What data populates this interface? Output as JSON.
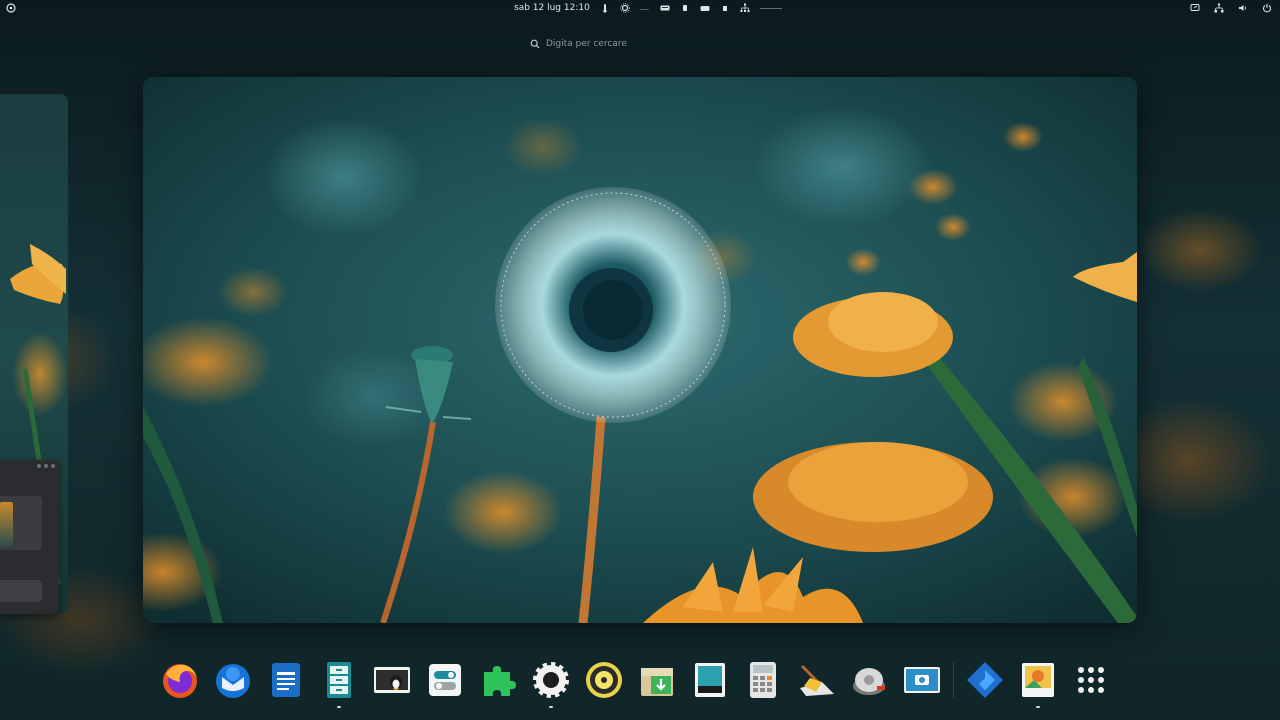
{
  "topbar": {
    "datetime": "sab 12 lug  12:10",
    "left_icon": "activities-icon",
    "status_icons": [
      "thermometer-icon",
      "sun-icon",
      "battery-icon",
      "keyboard-icon",
      "drive-icon",
      "usb-icon",
      "network-tree-icon"
    ],
    "right_icons": [
      "screen-share-icon",
      "network-icon",
      "volume-icon",
      "power-icon"
    ]
  },
  "search": {
    "placeholder": "Digita per cercare"
  },
  "dock": {
    "apps": [
      {
        "name": "firefox",
        "icon": "firefox-icon",
        "running": false
      },
      {
        "name": "thunderbird",
        "icon": "thunderbird-icon",
        "running": false
      },
      {
        "name": "writer",
        "icon": "document-writer-icon",
        "running": false
      },
      {
        "name": "file-cabinet",
        "icon": "file-cabinet-icon",
        "running": true
      },
      {
        "name": "terminal",
        "icon": "tux-terminal-icon",
        "running": false
      },
      {
        "name": "toggles",
        "icon": "toggle-settings-icon",
        "running": false
      },
      {
        "name": "extensions",
        "icon": "puzzle-extensions-icon",
        "running": false
      },
      {
        "name": "settings",
        "icon": "gear-icon",
        "running": true
      },
      {
        "name": "audio",
        "icon": "speaker-icon",
        "running": false
      },
      {
        "name": "software",
        "icon": "software-install-icon",
        "running": false
      },
      {
        "name": "display",
        "icon": "display-icon",
        "running": false
      },
      {
        "name": "calculator",
        "icon": "calculator-icon",
        "running": false
      },
      {
        "name": "cleaner",
        "icon": "broom-cleaner-icon",
        "running": false
      },
      {
        "name": "disk-utility",
        "icon": "disk-utility-icon",
        "running": false
      },
      {
        "name": "screenshot",
        "icon": "camera-screenshot-icon",
        "running": false
      },
      {
        "name": "kodi",
        "icon": "kodi-icon",
        "running": false
      },
      {
        "name": "image-viewer",
        "icon": "image-viewer-icon",
        "running": true
      },
      {
        "name": "app-grid",
        "icon": "app-grid-icon",
        "running": false
      }
    ]
  },
  "colors": {
    "accent": "#1f7a80",
    "dandelion_orange": "#e89428",
    "background_dark": "#0e1f22"
  }
}
